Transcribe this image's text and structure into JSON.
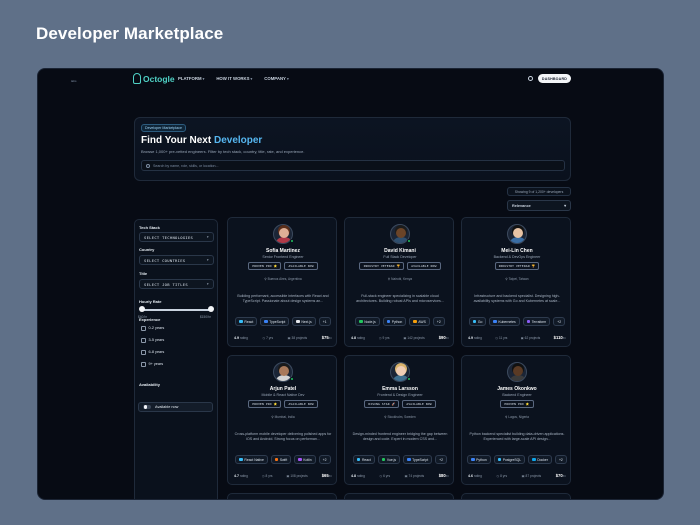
{
  "frame": {
    "title": "Developer Marketplace"
  },
  "nav": {
    "logo": "Octogle",
    "logo_sub": "labs",
    "links": [
      {
        "label": "PLATFORM"
      },
      {
        "label": "HOW IT WORKS"
      },
      {
        "label": "COMPANY"
      }
    ],
    "dashboard_label": "DASHBOARD"
  },
  "hero": {
    "badge": "Developer Marketplace",
    "title_prefix": "Find Your Next ",
    "title_accent": "Developer",
    "subtitle": "Browse 1,000+ pre-vetted engineers. Filter by tech stack, country, title, rate, and experience.",
    "search_placeholder": "Search by name, role, skills, or location..."
  },
  "results": {
    "showing": "Showing 9 of 1,200+ developers",
    "sort_label": "Relevance"
  },
  "filters": {
    "tech_stack_label": "Tech Stack",
    "tech_stack_value": "SELECT TECHNOLOGIES",
    "country_label": "Country",
    "country_value": "SELECT COUNTRIES",
    "title_label": "Title",
    "title_value": "SELECT JOB TITLES",
    "hourly_label": "Hourly Rate",
    "rate_min": "$40/hr",
    "rate_max": "$150/hr",
    "experience_label": "Experience",
    "experience_options": [
      "0-2 years",
      "3-5 years",
      "6-8 years",
      "9+ years"
    ],
    "availability_label": "Availability",
    "availability_value": "Available now"
  },
  "cards": [
    {
      "name": "Sofia Martinez",
      "role": "Senior Frontend Engineer",
      "badges": [
        "PROVEN PRO ⭐",
        "AVAILABLE NOW"
      ],
      "location": "Buenos Aires, Argentina",
      "desc": "Building performant, accessible interfaces with React and TypeScript. Passionate about design systems an...",
      "tags": [
        {
          "label": "React",
          "color": "#38bdf8"
        },
        {
          "label": "TypeScript",
          "color": "#3b82f6"
        },
        {
          "label": "Next.js",
          "color": "#e5e7eb"
        },
        {
          "label": "+1",
          "color": ""
        }
      ],
      "rating": "4.9",
      "rating_label": "rating",
      "years": "7 yrs",
      "projects": "38 projects",
      "rate": "$75",
      "rate_unit": "/hr",
      "skin": "#e0b096",
      "hair": "#5a2e1a",
      "shirt": "#b23a48",
      "online": true
    },
    {
      "name": "David Kimani",
      "role": "Full Stack Developer",
      "badges": [
        "INDUSTRY VETERAN 🏆",
        "AVAILABLE NOW"
      ],
      "location": "Nairobi, Kenya",
      "desc": "Full-stack engineer specializing in scalable cloud architectures. Building robust APIs and microservices...",
      "tags": [
        {
          "label": "Node.js",
          "color": "#22c55e"
        },
        {
          "label": "Python",
          "color": "#3b82f6"
        },
        {
          "label": "AWS",
          "color": "#f59e0b"
        },
        {
          "label": "+2",
          "color": ""
        }
      ],
      "rating": "4.8",
      "rating_label": "rating",
      "years": "9 yrs",
      "projects": "142 projects",
      "rate": "$90",
      "rate_unit": "/hr",
      "skin": "#6b4428",
      "hair": "#1c1c1c",
      "shirt": "#2f4f6f",
      "online": true
    },
    {
      "name": "Mei-Lin Chen",
      "role": "Backend & DevOps Engineer",
      "badges": [
        "INDUSTRY VETERAN 🏆"
      ],
      "location": "Taipei, Taiwan",
      "desc": "Infrastructure and backend specialist. Designing high-availability systems with Go and Kubernetes at scale...",
      "tags": [
        {
          "label": "Go",
          "color": "#38bdf8"
        },
        {
          "label": "Kubernetes",
          "color": "#3b82f6"
        },
        {
          "label": "Terraform",
          "color": "#8b5cf6"
        },
        {
          "label": "+2",
          "color": ""
        }
      ],
      "rating": "4.9",
      "rating_label": "rating",
      "years": "11 yrs",
      "projects": "62 projects",
      "rate": "$110",
      "rate_unit": "/hr",
      "skin": "#e8c4a6",
      "hair": "#121212",
      "shirt": "#3a6ea5",
      "online": false
    },
    {
      "name": "Arjun Patel",
      "role": "Mobile & React Native Dev",
      "badges": [
        "PROVEN PRO ⭐",
        "AVAILABLE NOW"
      ],
      "location": "Mumbai, India",
      "desc": "Cross-platform mobile developer delivering polished apps for iOS and Android. Strong focus on performan...",
      "tags": [
        {
          "label": "React Native",
          "color": "#38bdf8"
        },
        {
          "label": "Swift",
          "color": "#f97316"
        },
        {
          "label": "Kotlin",
          "color": "#a855f7"
        },
        {
          "label": "+2",
          "color": ""
        }
      ],
      "rating": "4.7",
      "rating_label": "rating",
      "years": "8 yrs",
      "projects": "108 projects",
      "rate": "$65",
      "rate_unit": "/hr",
      "skin": "#a9795a",
      "hair": "#1a1a1a",
      "shirt": "#d4d4d4",
      "online": true
    },
    {
      "name": "Emma Larsson",
      "role": "Frontend & Design Engineer",
      "badges": [
        "RISING STAR 🚀",
        "AVAILABLE NOW"
      ],
      "location": "Stockholm, Sweden",
      "desc": "Design-minded frontend engineer bridging the gap between design and code. Expert in modern CSS and...",
      "tags": [
        {
          "label": "React",
          "color": "#38bdf8"
        },
        {
          "label": "Vue.js",
          "color": "#22c55e"
        },
        {
          "label": "TypeScript",
          "color": "#3b82f6"
        },
        {
          "label": "+2",
          "color": ""
        }
      ],
      "rating": "4.8",
      "rating_label": "rating",
      "years": "6 yrs",
      "projects": "74 projects",
      "rate": "$80",
      "rate_unit": "/hr",
      "skin": "#f0cdb4",
      "hair": "#d9b36c",
      "shirt": "#3f6f8f",
      "online": true
    },
    {
      "name": "James Okonkwo",
      "role": "Backend Engineer",
      "badges": [
        "PROVEN PRO ⭐"
      ],
      "location": "Lagos, Nigeria",
      "desc": "Python backend specialist building data-driven applications. Experienced with large-scale API design...",
      "tags": [
        {
          "label": "Python",
          "color": "#3b82f6"
        },
        {
          "label": "PostgreSQL",
          "color": "#38bdf8"
        },
        {
          "label": "Docker",
          "color": "#0ea5e9"
        },
        {
          "label": "+2",
          "color": ""
        }
      ],
      "rating": "4.6",
      "rating_label": "rating",
      "years": "8 yrs",
      "projects": "87 projects",
      "rate": "$70",
      "rate_unit": "/hr",
      "skin": "#5a3a24",
      "hair": "#111111",
      "shirt": "#3b3b3b",
      "online": false
    }
  ],
  "colors": {
    "accent": "#56b6f0",
    "logo": "#4fd1c5",
    "online": "#22c55e"
  }
}
